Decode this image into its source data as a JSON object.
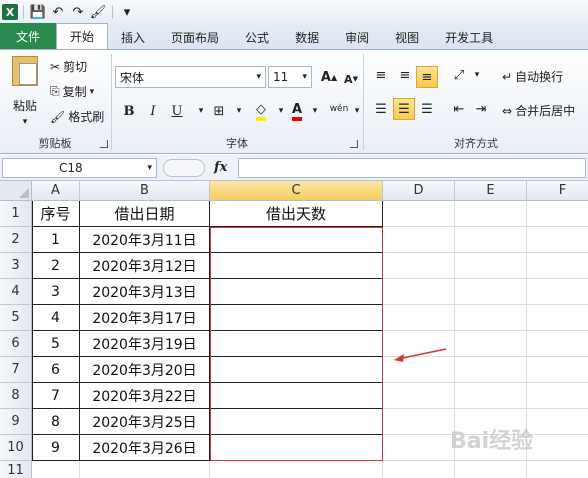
{
  "qat": {
    "icons": [
      "excel-logo",
      "save-icon",
      "undo-icon",
      "redo-icon",
      "format-painter-icon",
      "customize-icon"
    ]
  },
  "tabs": [
    "文件",
    "开始",
    "插入",
    "页面布局",
    "公式",
    "数据",
    "审阅",
    "视图",
    "开发工具"
  ],
  "ribbon": {
    "clipboard": {
      "paste": "粘贴",
      "cut": "剪切",
      "copy": "复制",
      "format_painter": "格式刷",
      "group": "剪贴板"
    },
    "font": {
      "name": "宋体",
      "size": "11",
      "bold": "B",
      "italic": "I",
      "underline": "U",
      "group": "字体",
      "phonetic": "wén"
    },
    "align": {
      "wrap": "自动换行",
      "merge": "合并后居中",
      "group": "对齐方式"
    }
  },
  "formula_bar": {
    "name_box": "C18",
    "fx": "fx",
    "value": ""
  },
  "columns": [
    "A",
    "B",
    "C",
    "D",
    "E",
    "F"
  ],
  "rows": [
    "1",
    "2",
    "3",
    "4",
    "5",
    "6",
    "7",
    "8",
    "9",
    "10",
    "11"
  ],
  "table": {
    "headers": [
      "序号",
      "借出日期",
      "借出天数"
    ],
    "rows": [
      [
        "1",
        "2020年3月11日",
        ""
      ],
      [
        "2",
        "2020年3月12日",
        ""
      ],
      [
        "3",
        "2020年3月13日",
        ""
      ],
      [
        "4",
        "2020年3月17日",
        ""
      ],
      [
        "5",
        "2020年3月19日",
        ""
      ],
      [
        "6",
        "2020年3月20日",
        ""
      ],
      [
        "7",
        "2020年3月22日",
        ""
      ],
      [
        "8",
        "2020年3月25日",
        ""
      ],
      [
        "9",
        "2020年3月26日",
        ""
      ]
    ]
  },
  "colors": {
    "file_tab": "#2a8a4d",
    "selected_col": "#f5cd5f",
    "annotation": "#d33"
  },
  "watermark": "Bai经验"
}
